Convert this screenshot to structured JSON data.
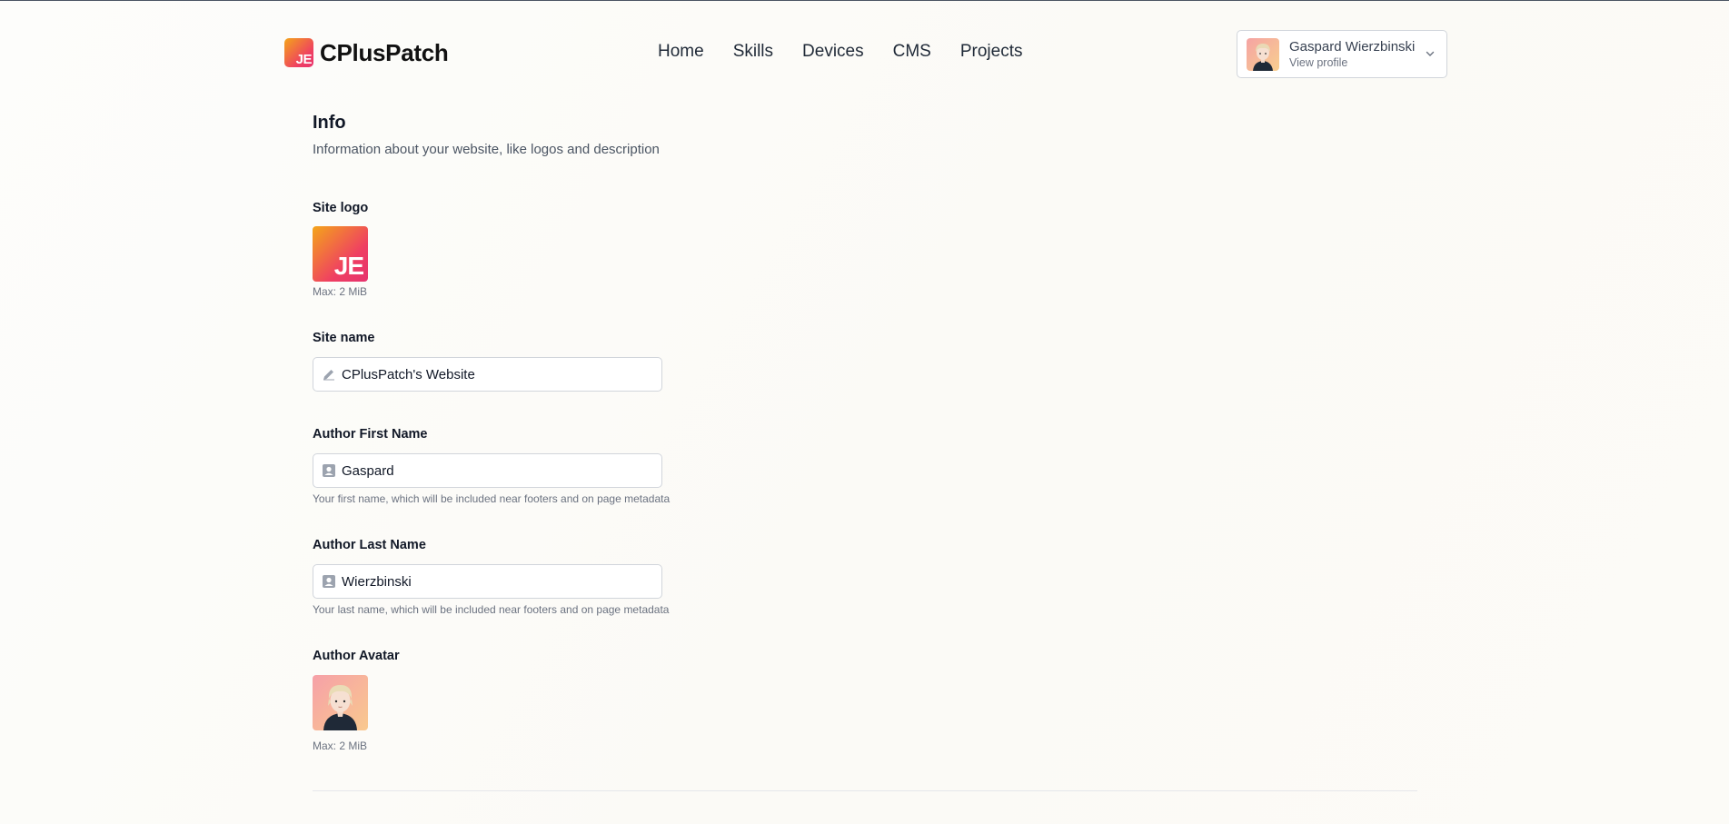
{
  "brand": {
    "badge": "JE",
    "name": "CPlusPatch"
  },
  "nav": [
    {
      "label": "Home"
    },
    {
      "label": "Skills"
    },
    {
      "label": "Devices"
    },
    {
      "label": "CMS"
    },
    {
      "label": "Projects"
    }
  ],
  "profile": {
    "name": "Gaspard Wierzbinski",
    "subtitle": "View profile",
    "icon": "chevron-down-icon"
  },
  "section": {
    "title": "Info",
    "description": "Information about your website, like logos and description"
  },
  "site_logo": {
    "label": "Site logo",
    "badge": "JE",
    "hint": "Max: 2 MiB"
  },
  "site_name": {
    "label": "Site name",
    "value": "CPlusPatch's Website",
    "icon": "pencil-icon"
  },
  "author_first": {
    "label": "Author First Name",
    "value": "Gaspard",
    "hint": "Your first name, which will be included near footers and on page metadata",
    "icon": "contact-card-icon"
  },
  "author_last": {
    "label": "Author Last Name",
    "value": "Wierzbinski",
    "hint": "Your last name, which will be included near footers and on page metadata",
    "icon": "contact-card-icon"
  },
  "author_avatar": {
    "label": "Author Avatar",
    "hint": "Max: 2 MiB"
  },
  "colors": {
    "accent_start": "#f4a51a",
    "accent_end": "#e8336d",
    "border": "#d1d5db"
  }
}
